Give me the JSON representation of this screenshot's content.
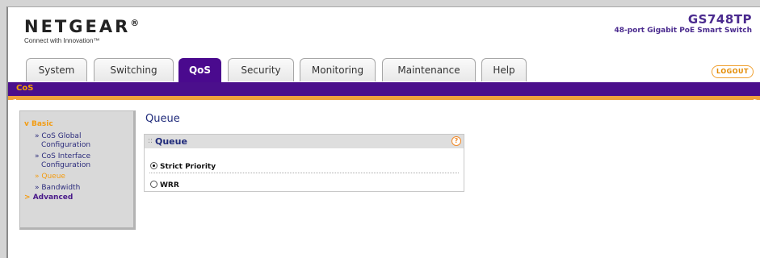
{
  "header": {
    "brand": "NETGEAR",
    "tagline": "Connect with Innovation™",
    "model": "GS748TP",
    "model_desc": "48-port Gigabit PoE Smart Switch",
    "logout_label": "LOGOUT"
  },
  "tabs": [
    {
      "label": "System"
    },
    {
      "label": "Switching"
    },
    {
      "label": "QoS",
      "active": true
    },
    {
      "label": "Security"
    },
    {
      "label": "Monitoring"
    },
    {
      "label": "Maintenance"
    },
    {
      "label": "Help"
    }
  ],
  "subnav": {
    "item": "CoS"
  },
  "leftnav": {
    "basic_label": "Basic",
    "items": [
      {
        "line1": "» CoS Global",
        "line2": "Configuration"
      },
      {
        "line1": "» CoS Interface",
        "line2": "Configuration"
      },
      {
        "line1": "» Queue",
        "active": true
      },
      {
        "line1": "» Bandwidth"
      }
    ],
    "advanced_label": "Advanced"
  },
  "main": {
    "page_title": "Queue",
    "panel_title": "Queue",
    "options": [
      {
        "label": "Strict Priority",
        "selected": true
      },
      {
        "label": "WRR",
        "selected": false
      }
    ]
  },
  "colors": {
    "primary_purple": "#4b0f8c",
    "accent_orange": "#f0a23c",
    "title_blue": "#1f2a7a"
  }
}
